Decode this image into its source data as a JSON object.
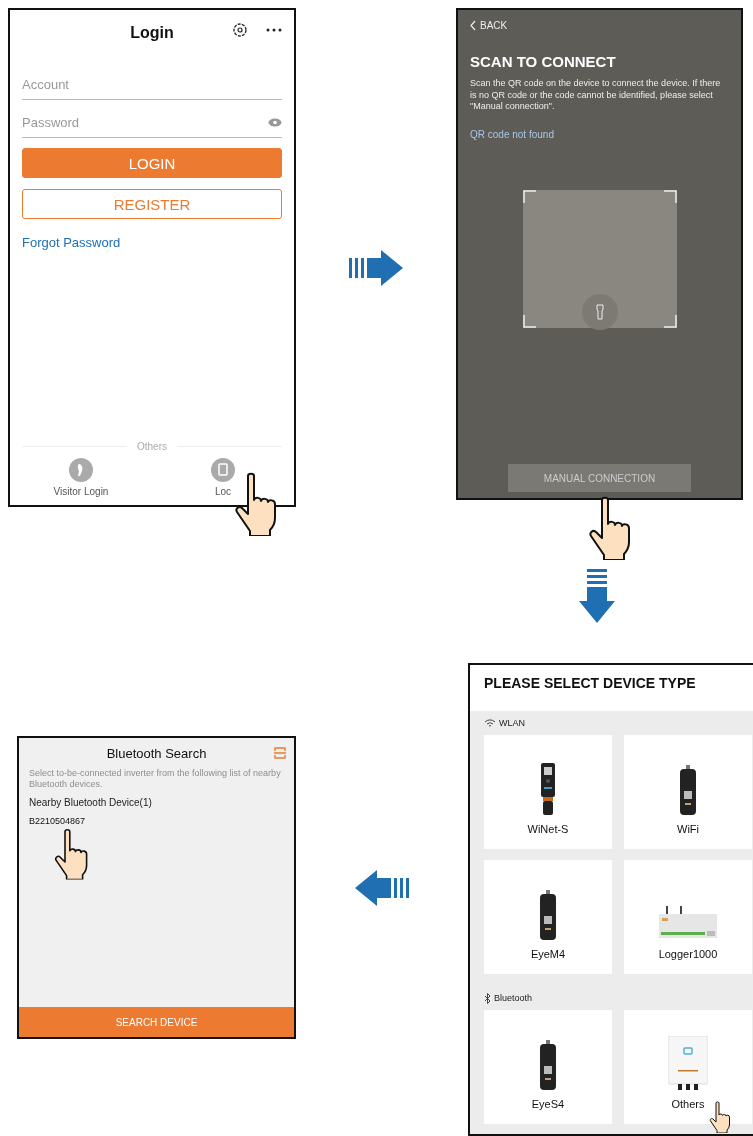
{
  "login_screen": {
    "title": "Login",
    "fields": [
      {
        "placeholder": "Account",
        "kind": "text"
      },
      {
        "placeholder": "Password",
        "kind": "password"
      }
    ],
    "buttons": [
      {
        "label": "LOGIN",
        "kind": "primary"
      },
      {
        "label": "REGISTER",
        "kind": "outline"
      }
    ],
    "link": "Forgot Password",
    "divider_label": "Others",
    "options": [
      {
        "label": "Visitor Login",
        "kind": "visitor"
      },
      {
        "label": "Loc",
        "kind": "local"
      }
    ]
  },
  "scan_screen": {
    "back": "BACK",
    "title": "SCAN TO CONNECT",
    "description": "Scan the QR code on the device to connect the device. If there is no QR code or the code cannot be identified, please select \"Manual connection\".",
    "status": "QR code not found",
    "button": "MANUAL CONNECTION"
  },
  "device_type_screen": {
    "title": "PLEASE SELECT DEVICE TYPE",
    "groups": [
      {
        "label": "WLAN",
        "kind": "wlan",
        "devices": [
          {
            "name": "WiNet-S",
            "kind": "winet"
          },
          {
            "name": "WiFi",
            "kind": "dongle"
          },
          {
            "name": "EyeM4",
            "kind": "dongle"
          },
          {
            "name": "Logger1000",
            "kind": "logger"
          }
        ]
      },
      {
        "label": "Bluetooth",
        "kind": "bluetooth",
        "devices": [
          {
            "name": "EyeS4",
            "kind": "dongle"
          },
          {
            "name": "Others",
            "kind": "inverter"
          }
        ]
      }
    ]
  },
  "bluetooth_screen": {
    "title": "Bluetooth Search",
    "hint": "Select to-be-connected inverter from the following list of nearby Bluetooth devices.",
    "section": "Nearby Bluetooth Device(1)",
    "devices": [
      "B2210504867"
    ],
    "button": "SEARCH DEVICE"
  }
}
